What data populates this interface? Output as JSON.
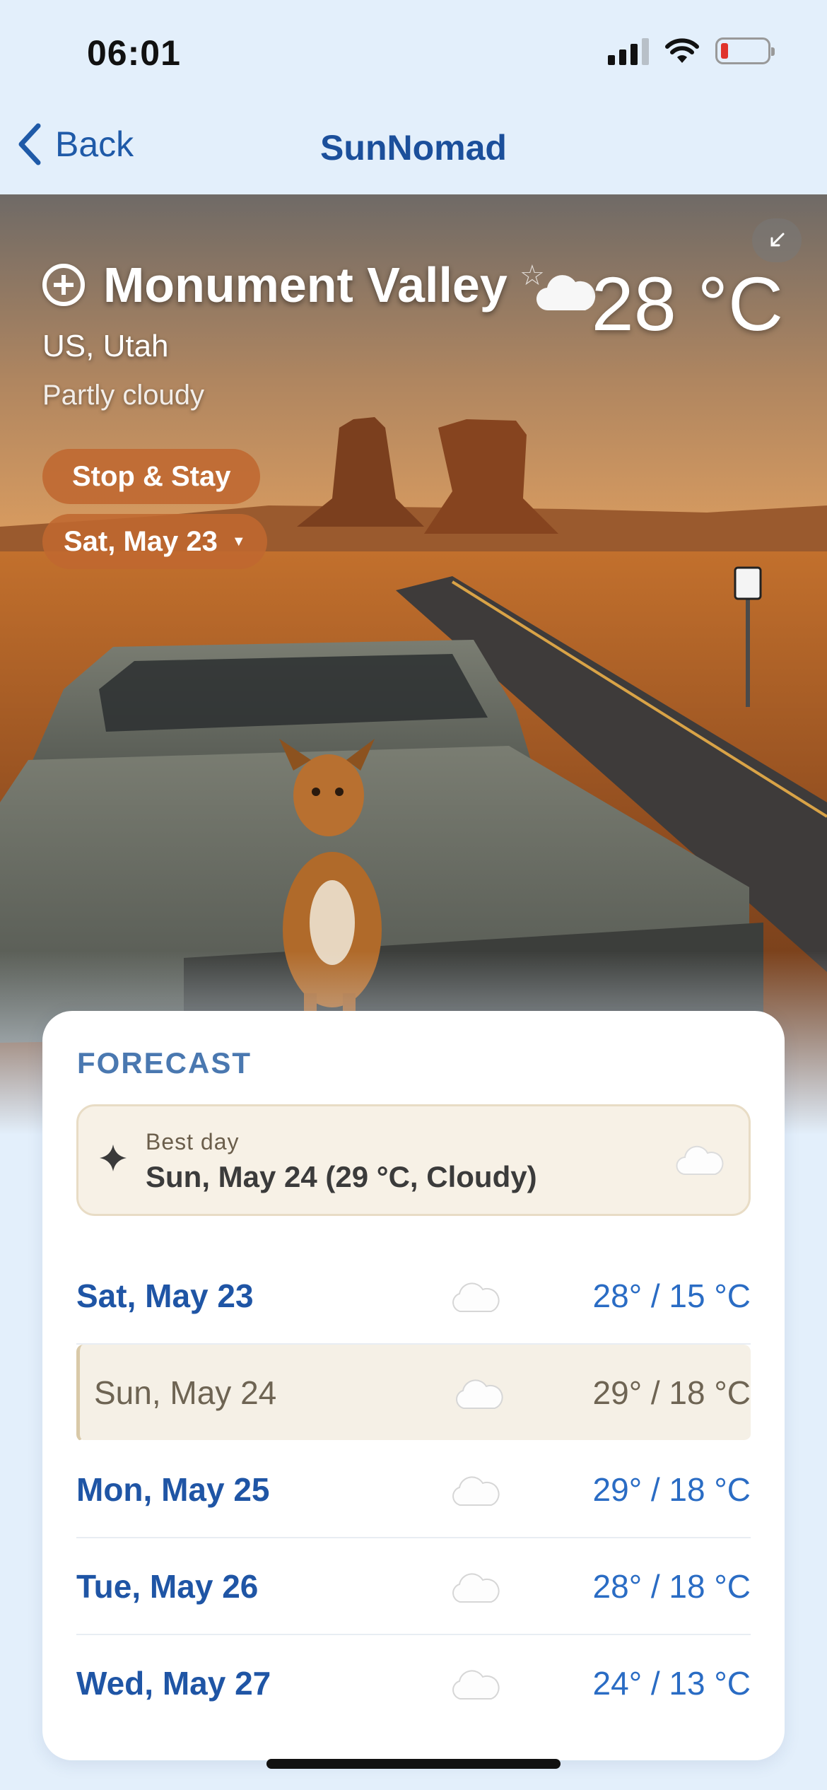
{
  "status_bar": {
    "time": "06:01",
    "battery_color": "#e0342c"
  },
  "nav": {
    "back_label": "Back",
    "title": "SunNomad"
  },
  "hero": {
    "place_name": "Monument Valley",
    "region": "US, Utah",
    "condition": "Partly cloudy",
    "temperature": "28 °C",
    "weather_icon": "cloud-icon",
    "stop_stay_label": "Stop & Stay",
    "selected_date": "Sat, May 23"
  },
  "forecast": {
    "title": "FORECAST",
    "best_day": {
      "label": "Best day",
      "value": "Sun, May 24 (29 °C, Cloudy)",
      "icon": "cloud-icon"
    },
    "days": [
      {
        "day": "Sat, May 23",
        "temp": "28° / 15 °C",
        "icon": "cloud-icon",
        "selected": false
      },
      {
        "day": "Sun, May 24",
        "temp": "29° / 18 °C",
        "icon": "cloud-icon",
        "selected": true
      },
      {
        "day": "Mon, May 25",
        "temp": "29° / 18 °C",
        "icon": "cloud-icon",
        "selected": false
      },
      {
        "day": "Tue, May 26",
        "temp": "28° / 18 °C",
        "icon": "cloud-icon",
        "selected": false
      },
      {
        "day": "Wed, May 27",
        "temp": "24° / 13 °C",
        "icon": "cloud-icon",
        "selected": false
      }
    ]
  },
  "colors": {
    "accent": "#1f55a5",
    "background": "#e3effb",
    "pill": "#bf6830",
    "best_day_bg": "#f7f1e6"
  }
}
